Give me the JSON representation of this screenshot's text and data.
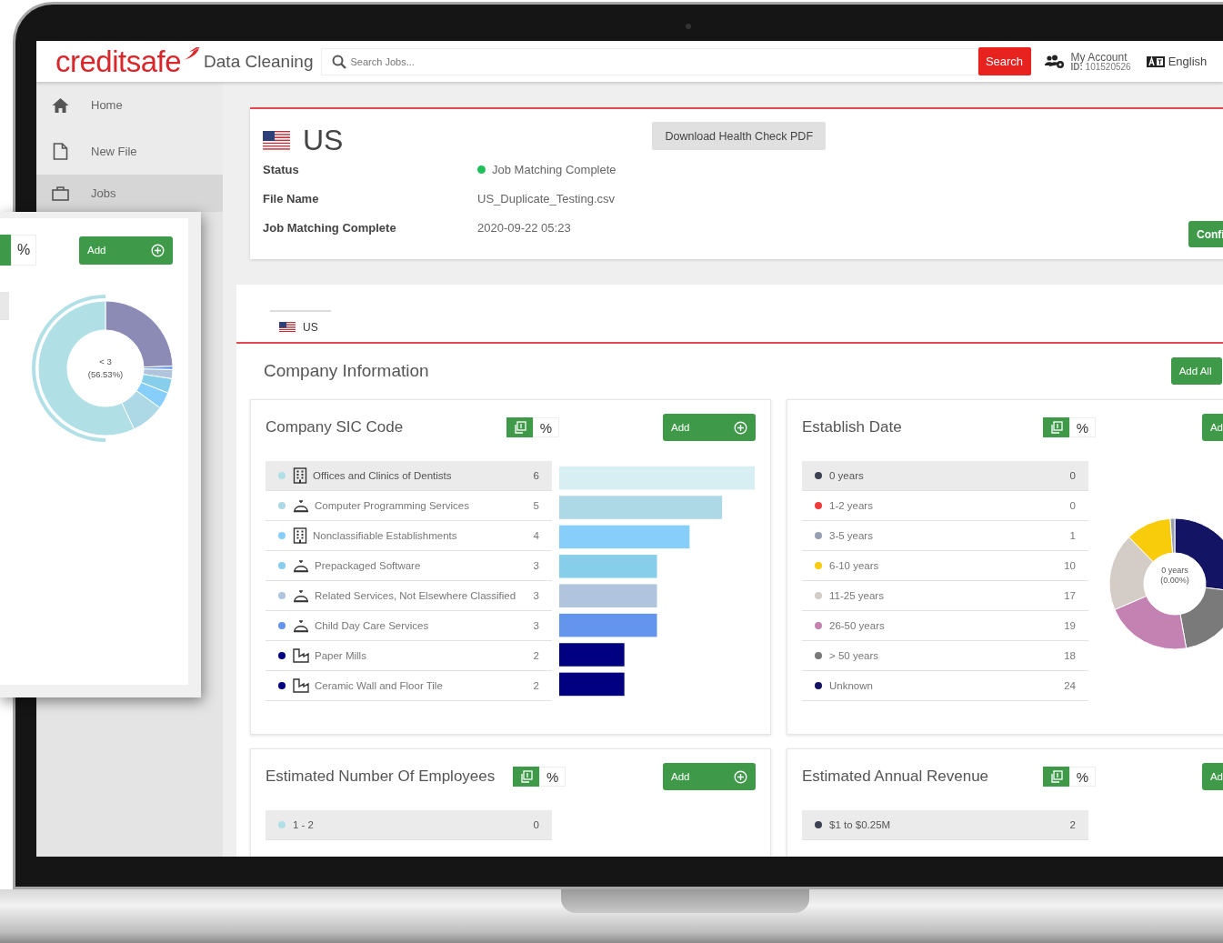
{
  "header": {
    "logo": "creditsafe",
    "app_title": "Data Cleaning",
    "search": {
      "placeholder": "Search Jobs...",
      "button": "Search"
    },
    "account": {
      "label": "My Account",
      "id": "**ID:** 101520526"
    },
    "language": "English"
  },
  "sidebar": {
    "items": [
      {
        "label": "Home",
        "kind": "home",
        "selected": false
      },
      {
        "label": "New File",
        "kind": "file",
        "selected": false
      },
      {
        "label": "Jobs",
        "kind": "jobs",
        "selected": true
      }
    ]
  },
  "job": {
    "title": "US",
    "download_button": "Download Health Check PDF",
    "confirm_button": "Confi",
    "fields": [
      {
        "label": "Status",
        "value": "Job Matching Complete",
        "color": "#22c05a"
      },
      {
        "label": "File Name",
        "value": "US_Duplicate_Testing.csv"
      },
      {
        "label": "Job Matching Complete",
        "value": "2020-09-22 05:23"
      }
    ]
  },
  "country_tabs": [
    {
      "label": "US",
      "selected": true
    }
  ],
  "section_title": "Company Information",
  "add_all_button": "Add All",
  "cards": [
    {
      "title": "Company SIC Code",
      "kind": "bars",
      "add_button": "Add",
      "toggle": [
        {
          "kind": "count",
          "selected": true
        },
        {
          "kind": "percent",
          "label": "%",
          "selected": false
        }
      ],
      "rows": [
        {
          "label": "Offices and Clinics of Dentists",
          "count": "6",
          "color": "#b0e0e6",
          "kind": "building",
          "selected": true
        },
        {
          "label": "Computer Programming Services",
          "count": "5",
          "color": "#add8e6",
          "kind": "bell",
          "selected": false
        },
        {
          "label": "Nonclassifiable Establishments",
          "count": "4",
          "color": "#87cefa",
          "kind": "building",
          "selected": false
        },
        {
          "label": "Prepackaged Software",
          "count": "3",
          "color": "#87ceeb",
          "kind": "bell",
          "selected": false
        },
        {
          "label": "Related Services, Not Elsewhere Classified",
          "count": "3",
          "color": "#b0c4de",
          "kind": "bell",
          "selected": false
        },
        {
          "label": "Child Day Care Services",
          "count": "3",
          "color": "#6495ed",
          "kind": "bell",
          "selected": false
        },
        {
          "label": "Paper Mills",
          "count": "2",
          "color": "#000080",
          "kind": "factory",
          "selected": false
        },
        {
          "label": "Ceramic Wall and Floor Tile",
          "count": "2",
          "color": "#000080",
          "kind": "factory",
          "selected": false
        }
      ]
    },
    {
      "title": "Establish Date",
      "kind": "donut",
      "add_button": "Ad",
      "donut_center": [
        "0 years",
        "(0.00%)"
      ],
      "toggle": [
        {
          "kind": "count",
          "selected": true
        },
        {
          "kind": "percent",
          "label": "%",
          "selected": false
        }
      ],
      "rows": [
        {
          "label": "0 years",
          "count": "0",
          "color": "#3d4353",
          "selected": true
        },
        {
          "label": "1-2 years",
          "count": "0",
          "color": "#ef3b3b",
          "selected": false
        },
        {
          "label": "3-5 years",
          "count": "1",
          "color": "#9aa0b4",
          "selected": false
        },
        {
          "label": "6-10 years",
          "count": "10",
          "color": "#f8cc0a",
          "selected": false
        },
        {
          "label": "11-25 years",
          "count": "17",
          "color": "#d4ccc6",
          "selected": false
        },
        {
          "label": "26-50 years",
          "count": "19",
          "color": "#c482b3",
          "selected": false
        },
        {
          "label": "> 50 years",
          "count": "18",
          "color": "#7a7a7a",
          "selected": false
        },
        {
          "label": "Unknown",
          "count": "24",
          "color": "#141464",
          "selected": false
        }
      ]
    },
    {
      "title": "Estimated Number Of Employees",
      "kind": "bars",
      "add_button": "Add",
      "toggle": [
        {
          "kind": "count",
          "selected": true
        },
        {
          "kind": "percent",
          "label": "%",
          "selected": false
        }
      ],
      "rows": [
        {
          "label": "1 - 2",
          "count": "0",
          "color": "#b0e0e6",
          "selected": true
        }
      ]
    },
    {
      "title": "Estimated Annual Revenue",
      "kind": "table",
      "add_button": "Ad",
      "toggle": [
        {
          "kind": "count",
          "selected": true
        },
        {
          "kind": "percent",
          "label": "%",
          "selected": false
        }
      ],
      "rows": [
        {
          "label": "$1 to $0.25M",
          "count": "2",
          "color": "#3d4353",
          "selected": true
        }
      ]
    }
  ],
  "floating_card": {
    "percent_label": "%",
    "add_button": "Add",
    "donut_center": [
      "< 3",
      "(56.53%)"
    ]
  }
}
